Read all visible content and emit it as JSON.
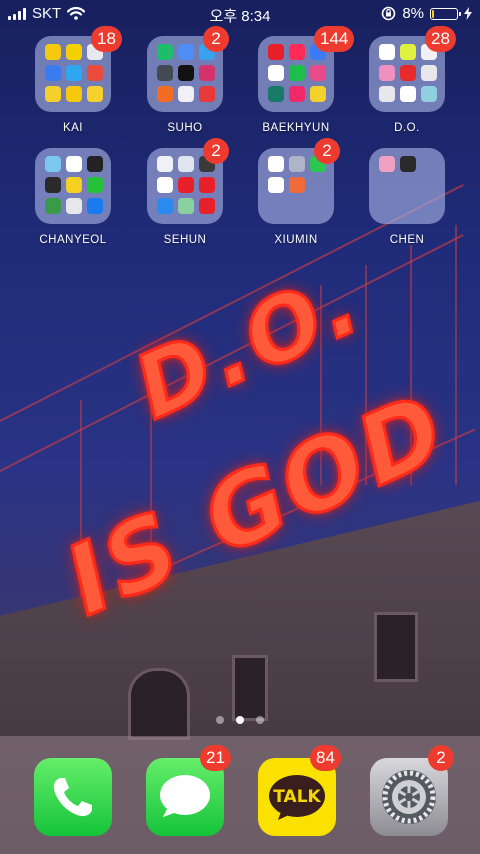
{
  "status_bar": {
    "carrier": "SKT",
    "time": "오후 8:34",
    "battery_percent": "8%",
    "battery_level": 0.08,
    "icons": [
      "signal-icon",
      "wifi-icon",
      "rotation-lock-icon",
      "battery-icon",
      "charging-icon"
    ]
  },
  "folders": [
    {
      "label": "KAI",
      "badge": "18",
      "minis": [
        "#f6c90e",
        "#f4d000",
        "#e8e8ef",
        "#3a7bf0",
        "#2ea6f0",
        "#e94b3c",
        "#f5d02a",
        "#f6c90e",
        "#f6d12c"
      ]
    },
    {
      "label": "SUHO",
      "badge": "2",
      "minis": [
        "#1fbd6a",
        "#4f8df5",
        "#3aa0f0",
        "#444a52",
        "#111111",
        "#d6336c",
        "#f26d21",
        "#f0f0f5",
        "#e83a3a"
      ]
    },
    {
      "label": "BAEKHYUN",
      "badge": "144",
      "minis": [
        "#e8202a",
        "#ff2a55",
        "#3b7bf5",
        "#ffffff",
        "#1fbd4a",
        "#e84a8a",
        "#1a7a6a",
        "#f02a6a",
        "#f6d12c"
      ]
    },
    {
      "label": "D.O.",
      "badge": "28",
      "minis": [
        "#ffffff",
        "#e0f040",
        "#f0f0f5",
        "#f090c0",
        "#e82a2a",
        "#e8e8ec",
        "#e8e8ec",
        "#ffffff",
        "#8fd0e0"
      ]
    },
    {
      "label": "CHANYEOL",
      "badge": "",
      "minis": [
        "#7ac8f0",
        "#ffffff",
        "#222222",
        "#2a2a2a",
        "#f5d020",
        "#26c23a",
        "#3a9a4a",
        "#e8e8ec",
        "#1a7af0"
      ]
    },
    {
      "label": "SEHUN",
      "badge": "2",
      "minis": [
        "#f0f0f5",
        "#e0e4f0",
        "#3a3a3a",
        "#ffffff",
        "#e8202a",
        "#e8202a",
        "#2a8af0",
        "#8ad0a0",
        "#e8202a"
      ]
    },
    {
      "label": "XIUMIN",
      "badge": "2",
      "minis": [
        "#ffffff",
        "#b0b4c8",
        "#2ac850",
        "#ffffff",
        "#f06a3a"
      ]
    },
    {
      "label": "CHEN",
      "badge": "",
      "minis": [
        "#f0a0c0",
        "#2a2a2a"
      ]
    }
  ],
  "page_dots": {
    "count": 3,
    "active": 1
  },
  "dock": [
    {
      "app": "Phone",
      "badge": ""
    },
    {
      "app": "Messages",
      "badge": "21"
    },
    {
      "app": "KakaoTalk",
      "badge": "84",
      "icon_text": "TALK"
    },
    {
      "app": "Settings",
      "badge": "2"
    }
  ],
  "wallpaper": {
    "line1": "D.O.",
    "line2": "IS GOD"
  }
}
